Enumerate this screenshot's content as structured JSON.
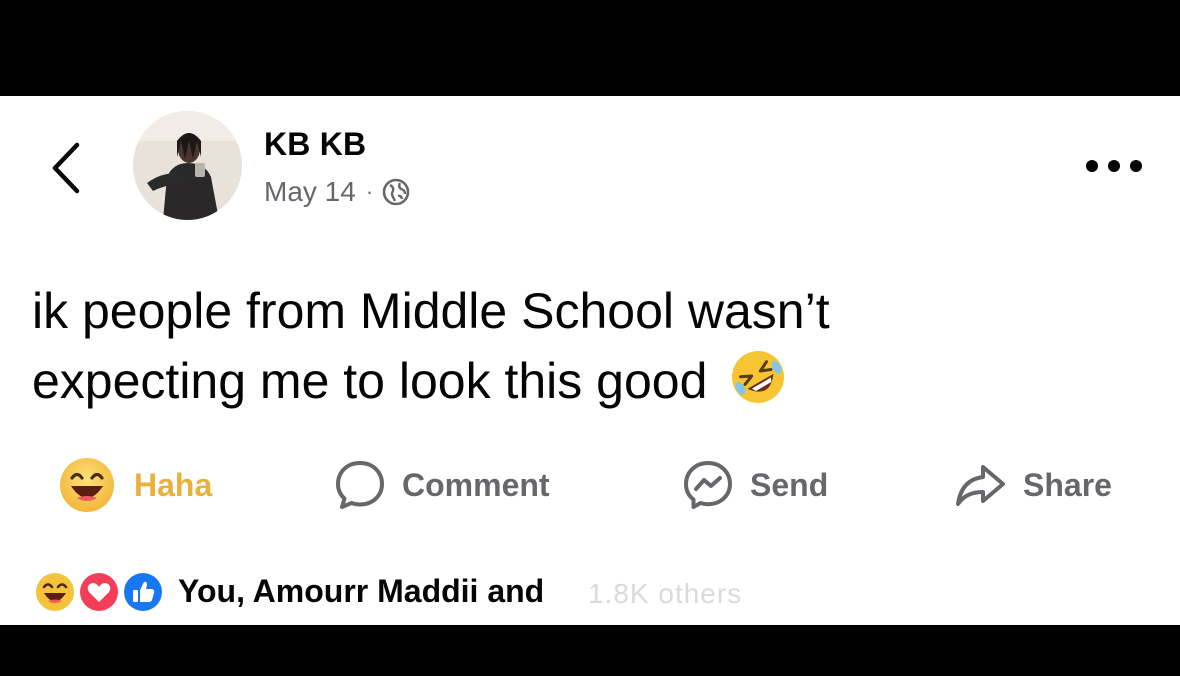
{
  "post": {
    "author": "KB KB",
    "date": "May 14",
    "separator": "·",
    "privacy_icon": "globe-icon",
    "text_line1": "ik people from Middle School wasn’t",
    "text_line2": "expecting me to look this good",
    "text_emoji": "rolling-on-floor-laughing-emoji"
  },
  "actions": {
    "haha_label": "Haha",
    "comment_label": "Comment",
    "send_label": "Send",
    "share_label": "Share"
  },
  "reactions": {
    "summary": "You, Amourr Maddii and",
    "watermark": "1.8K others"
  },
  "colors": {
    "haha_yellow": "#e8b13c",
    "muted_text": "#65676b",
    "like_blue": "#1877f2",
    "love_red": "#f33e58"
  }
}
